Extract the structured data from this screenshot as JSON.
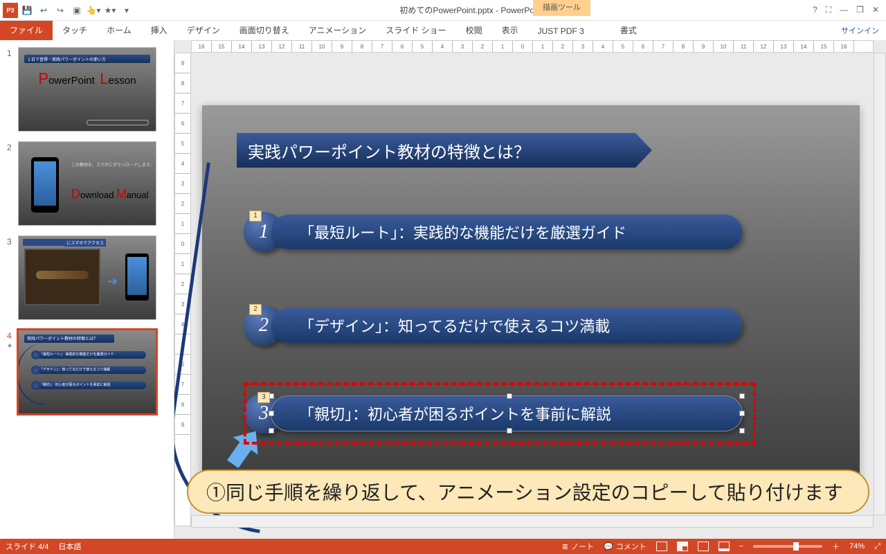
{
  "app": {
    "title": "初めてのPowerPoint.pptx - PowerPoint",
    "context_tab": "描画ツール",
    "signin": "サインイン"
  },
  "window_buttons": {
    "help": "?",
    "ribbon": "⛶",
    "min": "—",
    "max": "❐",
    "close": "✕"
  },
  "ribbon": {
    "file": "ファイル",
    "tabs": [
      "タッチ",
      "ホーム",
      "挿入",
      "デザイン",
      "画面切り替え",
      "アニメーション",
      "スライド ショー",
      "校閲",
      "表示",
      "JUST PDF 3"
    ],
    "format": "書式"
  },
  "ruler_h": [
    "16",
    "15",
    "14",
    "13",
    "12",
    "11",
    "10",
    "9",
    "8",
    "7",
    "6",
    "5",
    "4",
    "3",
    "2",
    "1",
    "0",
    "1",
    "2",
    "3",
    "4",
    "5",
    "6",
    "7",
    "8",
    "9",
    "10",
    "11",
    "12",
    "13",
    "14",
    "15",
    "16"
  ],
  "ruler_v": [
    "9",
    "8",
    "7",
    "6",
    "5",
    "4",
    "3",
    "2",
    "1",
    "0",
    "1",
    "2",
    "3",
    "4",
    "5",
    "6",
    "7",
    "8",
    "9"
  ],
  "thumbs": {
    "1": {
      "band": "１日で習得・実践パワーポイントの使い方",
      "big_p": "P",
      "big_rest1": "owerPoint",
      "big_l": "L",
      "big_rest2": "esson"
    },
    "2": {
      "line": "この教材を、スマホにダウンロードします。",
      "big_d": "D",
      "rest_d": "ownload",
      "big_m": "M",
      "rest_m": "anual"
    },
    "3": {
      "tag": "にスマホでアクセス"
    },
    "4": {
      "hdr": "実践パワーポイント教材の特徴とは？",
      "b1": "「最短ルート」：実践的な機能だけを厳選ガイド",
      "b2": "「デザイン」：知ってるだけで使えるコツ満載",
      "b3": "「親切」：初心者が困るポイントを事前に解説",
      "star": "★"
    }
  },
  "slide": {
    "title": "実践パワーポイント教材の特徴とは？",
    "bullets": [
      {
        "num": "1",
        "anim": "1",
        "text": "「最短ルート」：実践的な機能だけを厳選ガイド"
      },
      {
        "num": "2",
        "anim": "2",
        "text": "「デザイン」：知ってるだけで使えるコツ満載"
      },
      {
        "num": "3",
        "anim": "3",
        "text": "「親切」：初心者が困るポイントを事前に解説"
      }
    ]
  },
  "annotation": "①同じ手順を繰り返して、アニメーション設定のコピーして貼り付けます",
  "status": {
    "slide": "スライド 4/4",
    "lang": "日本語",
    "notes": "ノート",
    "comments": "コメント",
    "zoom_minus": "−",
    "zoom_plus": "＋",
    "zoom": "74%"
  }
}
